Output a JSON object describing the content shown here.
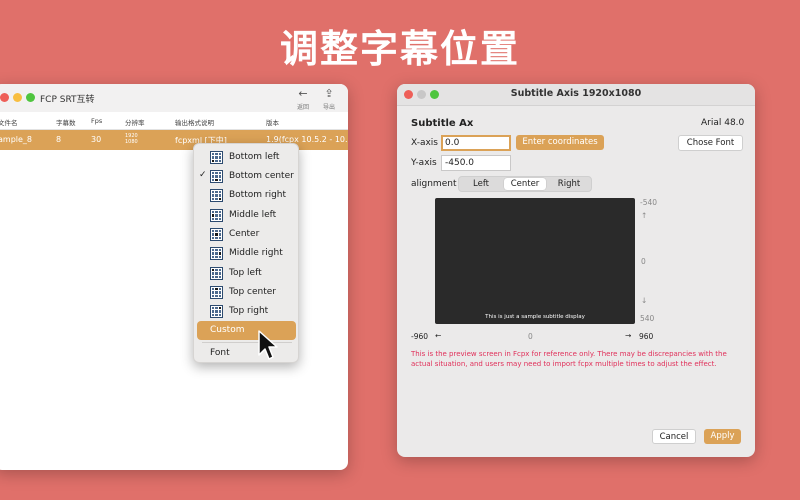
{
  "headline": "调整字幕位置",
  "left_window": {
    "title": "FCP SRT互转",
    "toolbar": {
      "back": {
        "icon": "arrow-left-icon",
        "label": "返回"
      },
      "export": {
        "icon": "export-icon",
        "label": "导出"
      }
    },
    "columns": [
      "文件名",
      "字幕数",
      "Fps",
      "分辨率",
      "输出格式说明",
      "版本"
    ],
    "rows": [
      {
        "file": "ample_8",
        "count": "8",
        "fps": "30",
        "res_w": "1920",
        "res_h": "1080",
        "format": "fcpxml [下中]",
        "version": "1.9(fcpx 10.5.2 - 10..."
      }
    ]
  },
  "menu": {
    "items": [
      {
        "label": "Bottom left",
        "checked": false
      },
      {
        "label": "Bottom center",
        "checked": true
      },
      {
        "label": "Bottom right",
        "checked": false
      },
      {
        "label": "Middle left",
        "checked": false
      },
      {
        "label": "Center",
        "checked": false
      },
      {
        "label": "Middle right",
        "checked": false
      },
      {
        "label": "Top left",
        "checked": false
      },
      {
        "label": "Top center",
        "checked": false
      },
      {
        "label": "Top right",
        "checked": false
      }
    ],
    "custom": "Custom",
    "font": "Font"
  },
  "right_window": {
    "title": "Subtitle Axis 1920x1080",
    "section_title": "Subtitle Ax",
    "font_info": "Arial 48.0",
    "x_label": "X-axis",
    "x_value": "0.0",
    "y_label": "Y-axis",
    "y_value": "-450.0",
    "enter_coords": "Enter coordinates",
    "chose_font": "Chose Font",
    "alignment_label": "alignment",
    "alignment": [
      "Left",
      "Center",
      "Right"
    ],
    "alignment_selected": "Center",
    "preview_text": "This is just a sample subtitle display",
    "y_ticks": {
      "top": "-540",
      "mid": "0",
      "bottom": "540"
    },
    "x_ticks": {
      "left": "-960",
      "mid": "0",
      "right": "960"
    },
    "note": "This is the preview screen in Fcpx for reference only. There may be discrepancies with the actual situation, and users may need to import fcpx multiple times to adjust the effect.",
    "cancel": "Cancel",
    "apply": "Apply"
  },
  "colors": {
    "background": "#e0706a",
    "accent": "#dba257",
    "note_red": "#e0305a"
  }
}
